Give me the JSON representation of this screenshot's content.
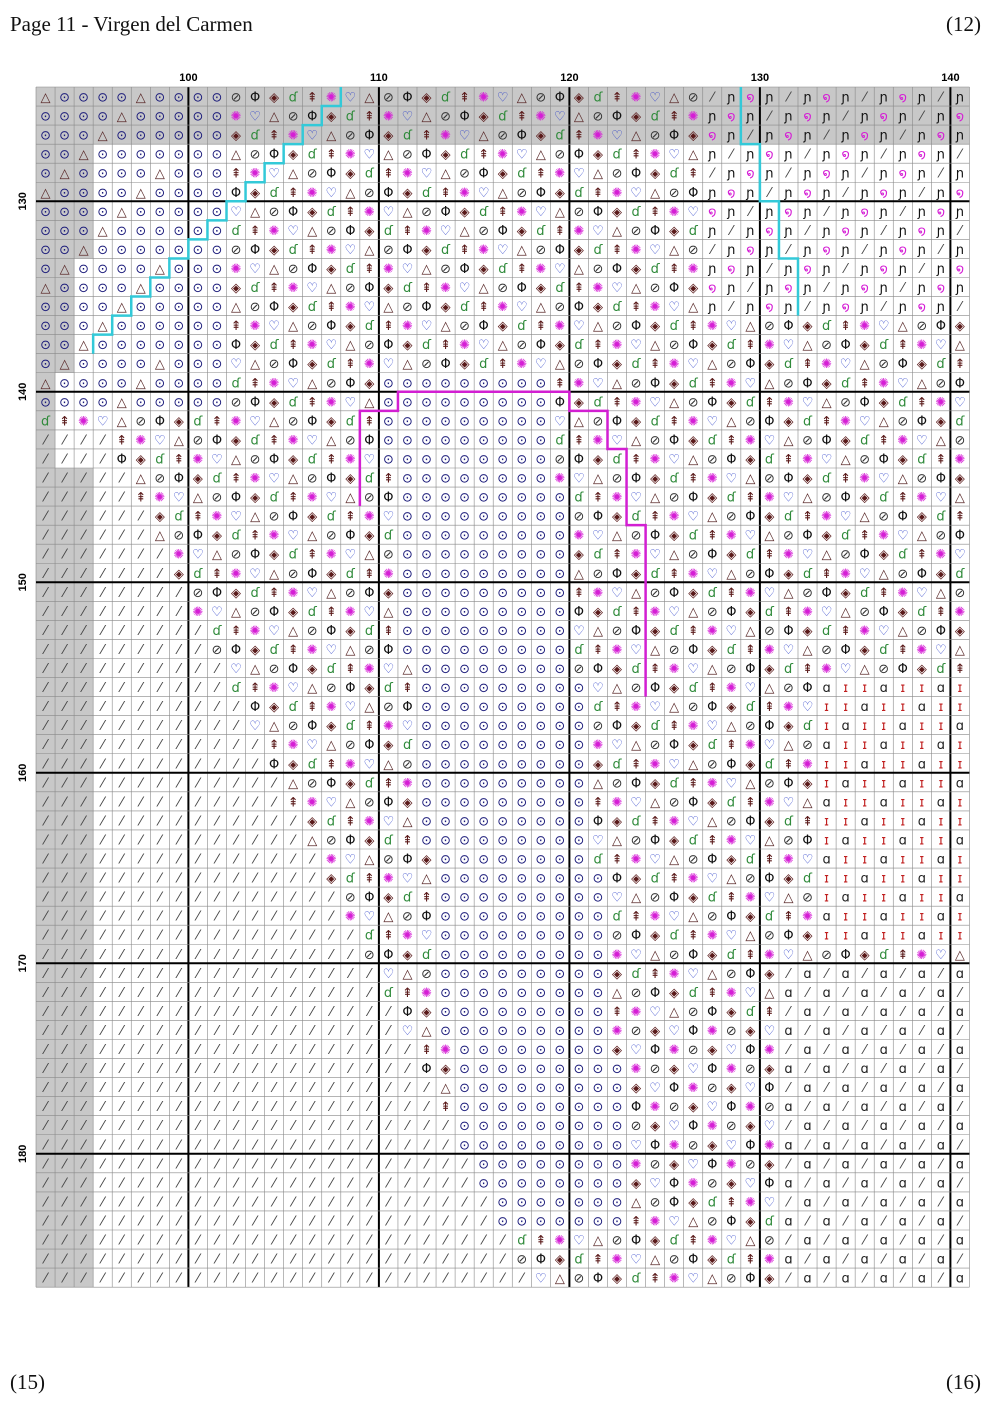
{
  "header": {
    "title": "Page 11  - Virgen del Carmen",
    "page_ref_right": "(12)"
  },
  "footer": {
    "page_ref_left": "(15)",
    "page_ref_right": "(16)"
  },
  "pattern_grid": {
    "col_start": 92,
    "col_end": 140,
    "row_start": 124,
    "row_end": 186,
    "column_labels": [
      "100",
      "110",
      "120",
      "130",
      "140"
    ],
    "row_labels": [
      "130",
      "140",
      "150",
      "160",
      "170",
      "180"
    ],
    "shaded_region_color": "#c8c8c8",
    "outline_colors": [
      "#33c9d8",
      "#d21fd2"
    ]
  },
  "symbols": {
    "target": {
      "glyph": "⊙",
      "color": "#1a1a7a"
    },
    "triangle": {
      "glyph": "△",
      "color": "#5a2a2a"
    },
    "slash": {
      "glyph": "⁄",
      "color": "#444444"
    },
    "swirl-green": {
      "glyph": "ɗ",
      "color": "#2f8a3a"
    },
    "heart": {
      "glyph": "♡",
      "color": "#2b3fc8"
    },
    "sun": {
      "glyph": "✺",
      "color": "#d51ed5"
    },
    "arrow-up": {
      "glyph": "⇞",
      "color": "#5a1a1a"
    },
    "diamond": {
      "glyph": "◈",
      "color": "#5a1a1a"
    },
    "phi": {
      "glyph": "Φ",
      "color": "#111111"
    },
    "oval": {
      "glyph": "⊘",
      "color": "#333333"
    },
    "cross": {
      "glyph": "✚",
      "color": "#2b3fc8"
    },
    "spiral-pink": {
      "glyph": "໑",
      "color": "#d51ed5"
    },
    "hook": {
      "glyph": "ɲ",
      "color": "#111111"
    },
    "alpha": {
      "glyph": "ɑ",
      "color": "#222222"
    },
    "i-red": {
      "glyph": "ɪ",
      "color": "#c01f1f"
    },
    "square-blue": {
      "glyph": "□",
      "color": "#2b3fc8"
    }
  }
}
